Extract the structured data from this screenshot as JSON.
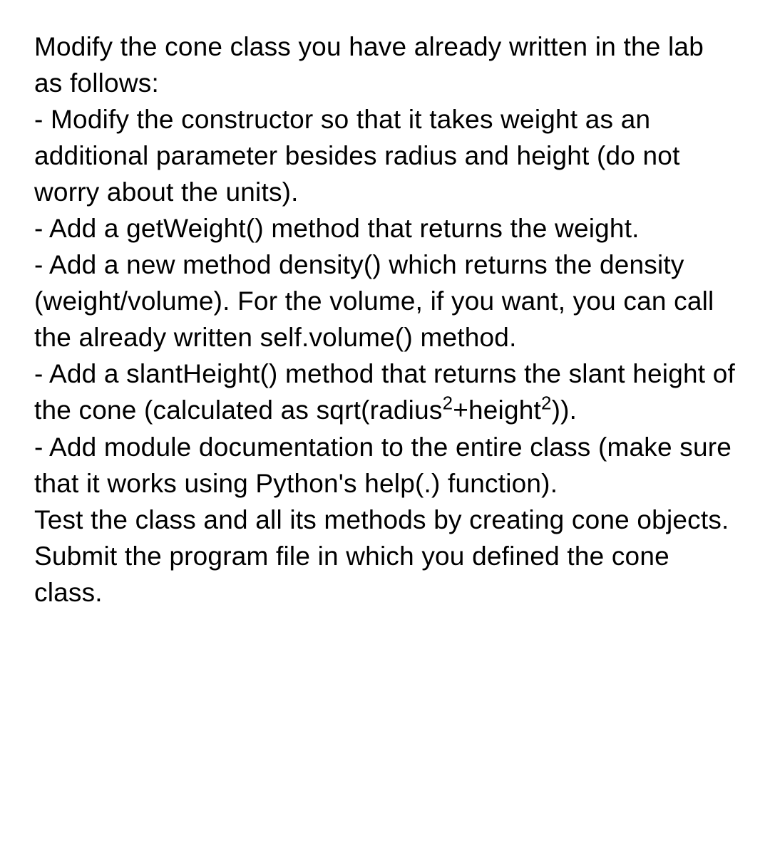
{
  "intro": "Modify the cone class you have already written in the lab as follows:",
  "bullets": [
    {
      "prefix": "- ",
      "text": "Modify the constructor so that it takes weight as an additional parameter besides radius and height (do not worry about the units)."
    },
    {
      "prefix": "- ",
      "text": "Add a getWeight() method that returns the weight."
    },
    {
      "prefix": "- ",
      "text": "Add a new method density() which returns the density (weight/volume). For the volume, if you want, you can call the already written self.volume() method."
    },
    {
      "prefix": "- ",
      "text_pre": "Add a slantHeight() method that returns the slant height of the cone (calculated as sqrt(radius",
      "sup1": "2",
      "mid": "+height",
      "sup2": "2",
      "text_post": "))."
    },
    {
      "prefix": "- ",
      "text": "Add module documentation to the entire class (make sure that it works using Python's help(.) function)."
    }
  ],
  "closing": "Test the class and all its methods by creating cone objects. Submit the program file in which you defined the cone class."
}
